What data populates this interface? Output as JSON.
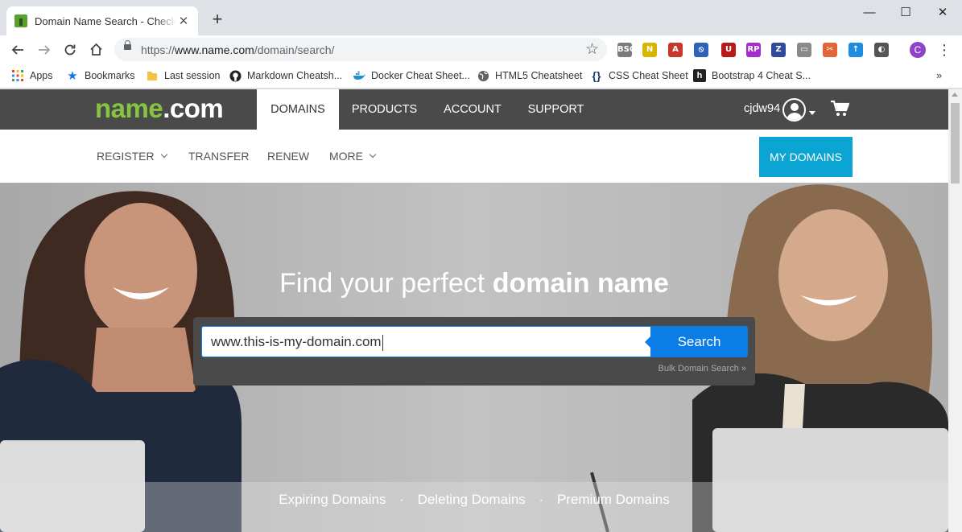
{
  "browser": {
    "tab_title": "Domain Name Search - Check Do",
    "tab_close": "✕",
    "new_tab": "+",
    "url_prefix": "https://",
    "url_host": "www.name.com",
    "url_path": "/domain/search/",
    "window_controls": {
      "minimize": "—",
      "maximize": "☐",
      "close": "✕"
    }
  },
  "bookmarks": [
    {
      "label": "Apps",
      "icon": "apps-grid-icon"
    },
    {
      "label": "Bookmarks",
      "icon": "star-icon"
    },
    {
      "label": "Last session",
      "icon": "folder-icon"
    },
    {
      "label": "Markdown Cheatsh...",
      "icon": "github-icon"
    },
    {
      "label": "Docker Cheat Sheet...",
      "icon": "docker-icon"
    },
    {
      "label": "HTML5 Cheatsheet",
      "icon": "globe-icon"
    },
    {
      "label": "CSS Cheat Sheet",
      "icon": "braces-icon"
    },
    {
      "label": "Bootstrap 4 Cheat S...",
      "icon": "h-icon"
    }
  ],
  "extensions": [
    {
      "label": "BSC",
      "color": "#7b7b7b"
    },
    {
      "label": "N",
      "color": "#d7b500"
    },
    {
      "label": "A",
      "color": "#c8372d"
    },
    {
      "label": "⦸",
      "color": "#2e63b8"
    },
    {
      "label": "U",
      "color": "#b71c1c"
    },
    {
      "label": "RP",
      "color": "#a62bd0"
    },
    {
      "label": "Z",
      "color": "#2f4b9a"
    },
    {
      "label": "▭",
      "color": "#8a8a8a"
    },
    {
      "label": "✂",
      "color": "#e0663a"
    },
    {
      "label": "↑",
      "color": "#1d8de0"
    },
    {
      "label": "◐",
      "color": "#555555"
    }
  ],
  "profile_initial": "C",
  "site": {
    "logo_green": "name",
    "logo_white": ".com",
    "nav": [
      "DOMAINS",
      "PRODUCTS",
      "ACCOUNT",
      "SUPPORT"
    ],
    "username": "cjdw94",
    "subnav": [
      {
        "label": "REGISTER",
        "dropdown": true
      },
      {
        "label": "TRANSFER",
        "dropdown": false
      },
      {
        "label": "RENEW",
        "dropdown": false
      },
      {
        "label": "MORE",
        "dropdown": true
      }
    ],
    "my_domains": "MY DOMAINS",
    "hero": {
      "title_light": "Find your perfect ",
      "title_bold": "domain name",
      "search_value": "www.this-is-my-domain.com",
      "search_button": "Search",
      "bulk_link": "Bulk Domain Search »"
    },
    "footer_links": [
      "Expiring Domains",
      "Deleting Domains",
      "Premium Domains"
    ],
    "footer_separator": "·"
  },
  "colors": {
    "brand_green": "#86c440",
    "nav_dark": "#4a4a4a",
    "accent_cyan": "#0aa5d2",
    "search_blue": "#0b7de6"
  }
}
